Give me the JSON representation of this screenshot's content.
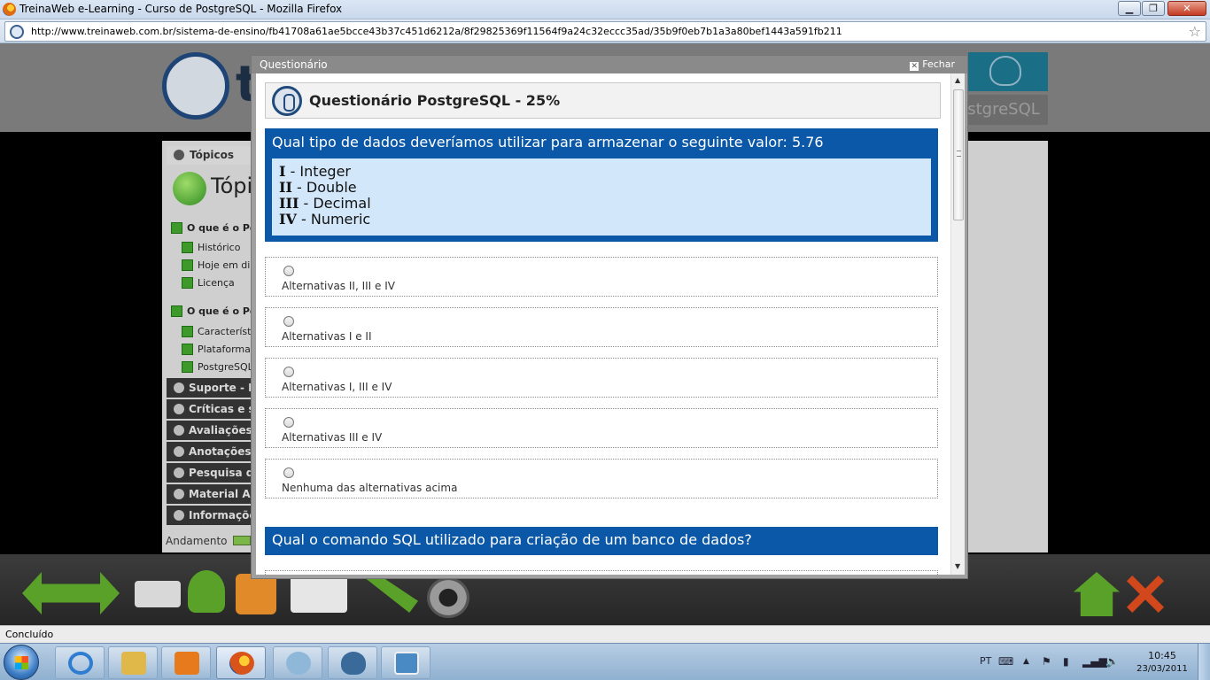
{
  "window": {
    "title": "TreinaWeb e-Learning - Curso de PostgreSQL - Mozilla Firefox",
    "min_label": "▁",
    "max_label": "❐",
    "close_label": "✕"
  },
  "browser": {
    "url": "http://www.treinaweb.com.br/sistema-de-ensino/fb41708a61ae5bcce43b37c451d6212a/8f29825369f11564f9a24c32eccc35ad/35b9f0eb7b1a3a80bef1443a591fb211",
    "status": "Concluído"
  },
  "page": {
    "logo_letter": "t",
    "banner_text": "PostgreSQL",
    "sidebar": {
      "header": "Tópicos",
      "topics_title": "Tópicos",
      "groups": [
        {
          "label": "O que é o PostgreSQL?",
          "items": [
            "Histórico",
            "Hoje em dia",
            "Licença"
          ]
        },
        {
          "label": "O que é o PostgreSQL?",
          "items": [
            "Características",
            "Plataformas",
            "PostgreSQL"
          ]
        }
      ],
      "categories": [
        "Suporte - PostgreSQL",
        "Críticas e sugestões",
        "Avaliações",
        "Anotações",
        "Pesquisa de satisfação",
        "Material Adicional",
        "Informações"
      ],
      "andamento": "Andamento"
    }
  },
  "modal": {
    "title": "Questionário",
    "close_label": "Fechar",
    "quiz_title": "Questionário PostgreSQL - 25%",
    "questions": [
      {
        "text": "Qual tipo de dados deveríamos utilizar para armazenar o seguinte valor: 5.76",
        "details": [
          {
            "num": "I",
            "text": " - Integer"
          },
          {
            "num": "II",
            "text": " - Double"
          },
          {
            "num": "III",
            "text": " - Decimal"
          },
          {
            "num": "IV",
            "text": " - Numeric"
          }
        ],
        "options": [
          "Alternativas II, III e IV",
          "Alternativas I e II",
          "Alternativas I, III e IV",
          "Alternativas III e IV",
          "Nenhuma das alternativas acima"
        ]
      },
      {
        "text": "Qual o comando SQL utilizado para criação de um banco de dados?"
      }
    ]
  },
  "taskbar": {
    "language": "PT",
    "time": "10:45",
    "date": "23/03/2011",
    "items": [
      {
        "name": "internet-explorer-icon",
        "color": "#2f7dd1"
      },
      {
        "name": "windows-explorer-icon",
        "color": "#e0b84a"
      },
      {
        "name": "media-player-icon",
        "color": "#e87a1e"
      },
      {
        "name": "firefox-icon",
        "color": "#d8541a"
      },
      {
        "name": "paint-icon",
        "color": "#8fb8d8"
      },
      {
        "name": "postgresql-icon",
        "color": "#3a6a9a"
      },
      {
        "name": "image-viewer-icon",
        "color": "#4a8ac4"
      }
    ]
  },
  "colors": {
    "question_blue": "#0b58a8",
    "detail_bg": "#d3e7fb",
    "modal_gray": "#a0a0a0"
  }
}
